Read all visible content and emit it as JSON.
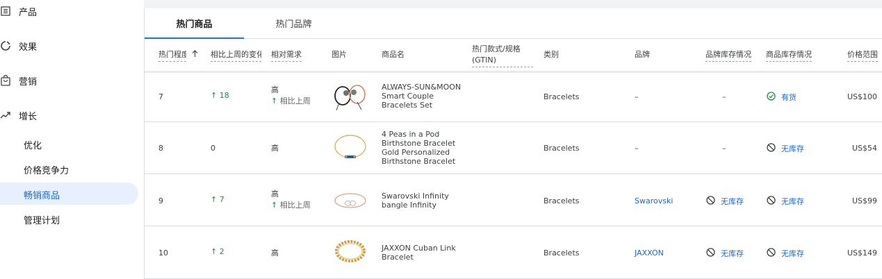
{
  "sidebar": {
    "nav": [
      {
        "label": "产品",
        "icon": "list-box-icon"
      },
      {
        "label": "效果",
        "icon": "circle-gauge-icon"
      },
      {
        "label": "营销",
        "icon": "shopping-bag-icon"
      },
      {
        "label": "增长",
        "icon": "trending-up-icon"
      }
    ],
    "sub": [
      {
        "label": "优化",
        "active": false
      },
      {
        "label": "价格竞争力",
        "active": false
      },
      {
        "label": "畅销商品",
        "active": true
      },
      {
        "label": "管理计划",
        "active": false
      }
    ]
  },
  "tabs": [
    {
      "label": "热门商品",
      "active": true
    },
    {
      "label": "热门品牌",
      "active": false
    }
  ],
  "columns": {
    "rank": "热门程度",
    "change": "相比上周的变化",
    "demand": "相对需求",
    "image": "图片",
    "name": "商品名",
    "gtin_line1": "热门款式/规格",
    "gtin_line2": "(GTIN)",
    "category": "类别",
    "brand": "品牌",
    "brand_stock": "品牌库存情况",
    "product_stock": "商品库存情况",
    "price": "价格范围"
  },
  "rows": [
    {
      "rank": "7",
      "change": "18",
      "change_dir": "up",
      "demand": "高",
      "demand_note": "相比上周",
      "name": "ALWAYS-SUN&MOON Smart Couple Bracelets Set",
      "gtin": "",
      "category": "Bracelets",
      "brand": "–",
      "brand_stock": "–",
      "product_stock": "有货",
      "product_stock_status": "in-stock",
      "price": "US$100",
      "image": "couple-bracelets-image"
    },
    {
      "rank": "8",
      "change": "0",
      "change_dir": "none",
      "demand": "高",
      "demand_note": "",
      "name": "4 Peas in a Pod Birthstone Bracelet Gold Personalized Birthstone Bracelet",
      "gtin": "",
      "category": "Bracelets",
      "brand": "–",
      "brand_stock": "–",
      "product_stock": "无库存",
      "product_stock_status": "out-of-stock",
      "price": "US$54",
      "image": "birthstone-bracelet-image"
    },
    {
      "rank": "9",
      "change": "7",
      "change_dir": "up",
      "demand": "高",
      "demand_note": "相比上周",
      "name": "Swarovski Infinity bangle Infinity",
      "gtin": "",
      "category": "Bracelets",
      "brand": "Swarovski",
      "brand_stock": "无库存",
      "product_stock": "无库存",
      "product_stock_status": "out-of-stock",
      "price": "US$99",
      "image": "infinity-bangle-image"
    },
    {
      "rank": "10",
      "change": "2",
      "change_dir": "up",
      "demand": "高",
      "demand_note": "",
      "name": "JAXXON Cuban Link Bracelet",
      "gtin": "",
      "category": "Bracelets",
      "brand": "JAXXON",
      "brand_stock": "无库存",
      "product_stock": "无库存",
      "product_stock_status": "out-of-stock",
      "price": "US$149",
      "image": "cuban-link-bracelet-image"
    }
  ],
  "colors": {
    "accent": "#1a73e8",
    "green": "#1e8e3e",
    "active_bg": "#e8f0fe"
  }
}
